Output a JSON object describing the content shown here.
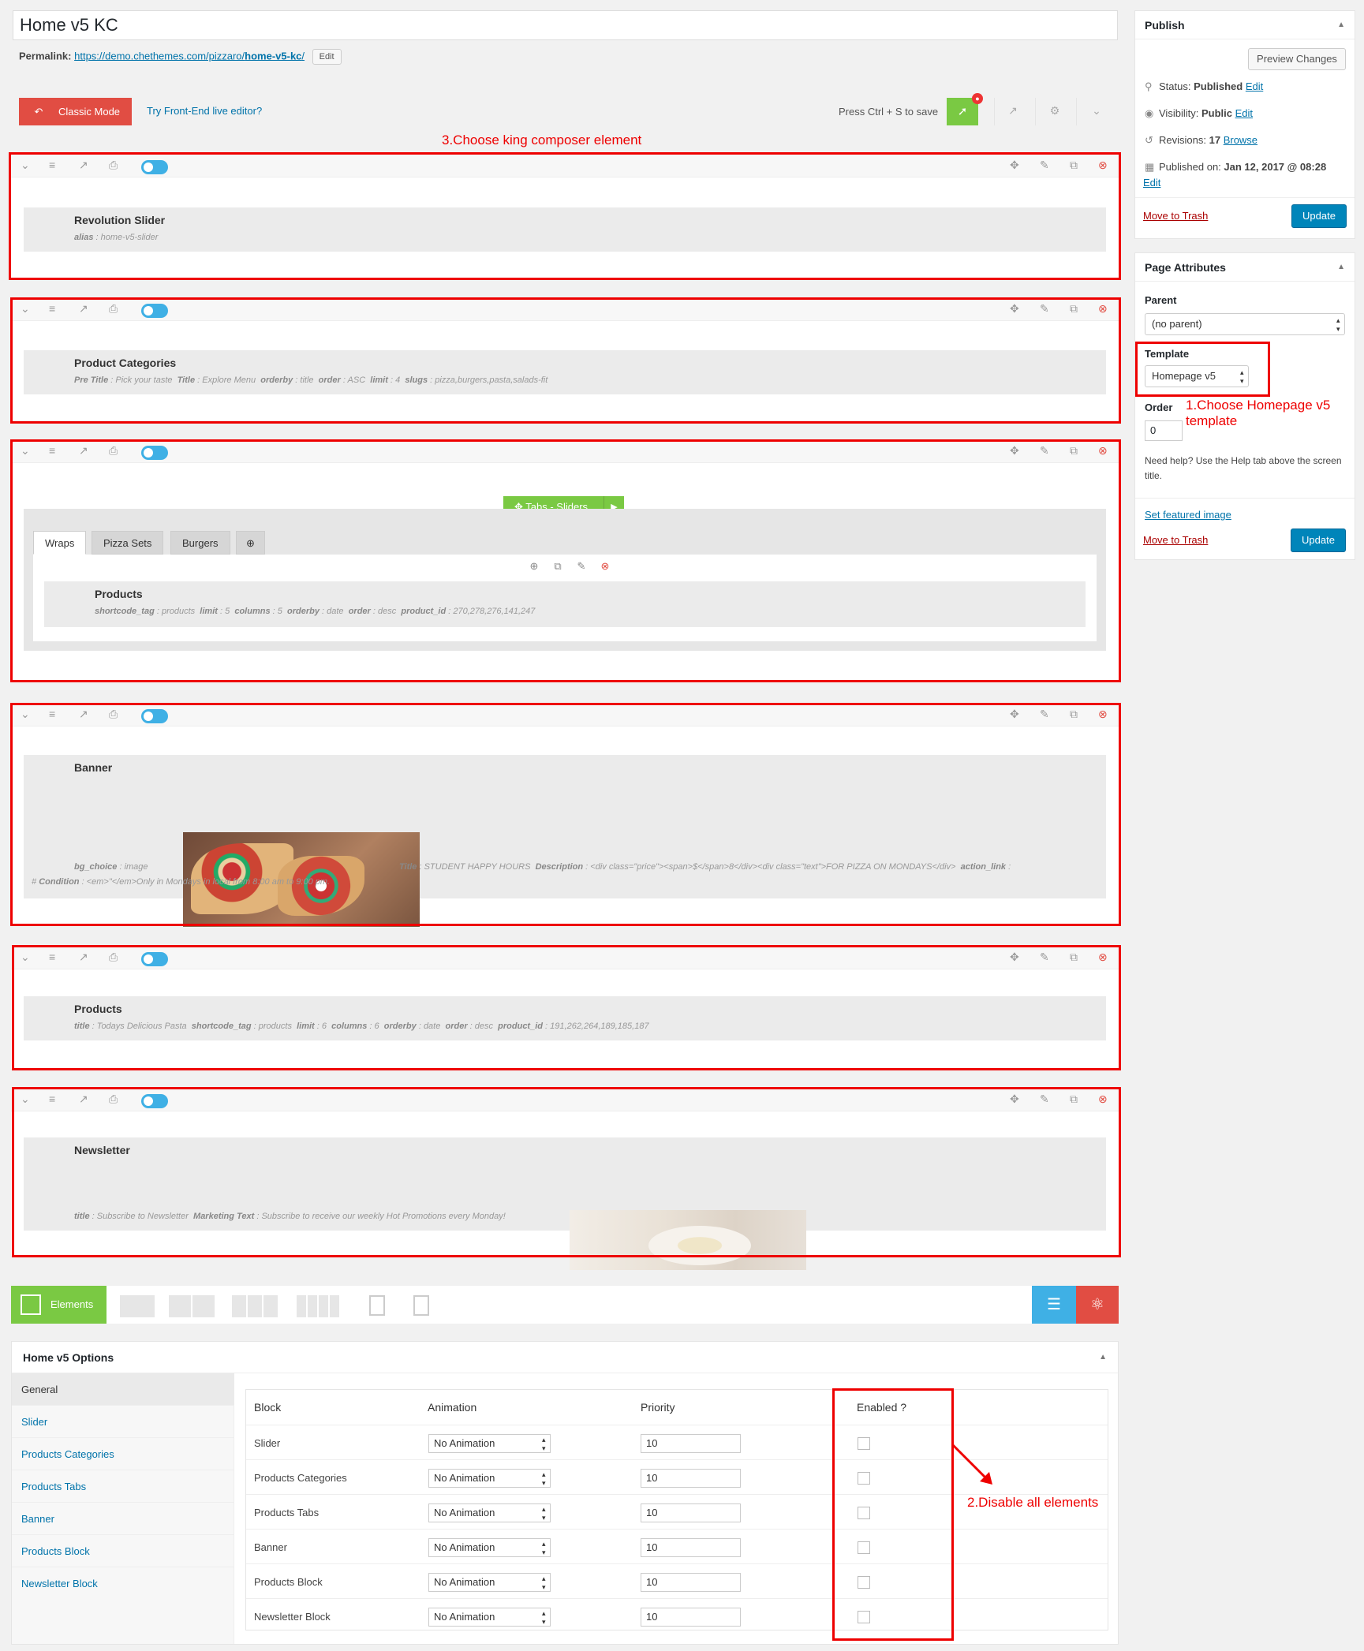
{
  "post": {
    "title": "Home v5 KC",
    "permalink_label": "Permalink:",
    "permalink_base": "https://demo.chethemes.com/pizzaro/",
    "permalink_slug": "home-v5-kc",
    "permalink_end": "/",
    "edit_label": "Edit"
  },
  "kc_toolbar": {
    "classic_mode": "Classic Mode",
    "frontend_link": "Try Front-End live editor?",
    "save_hint": "Press Ctrl + S to save"
  },
  "annotations": {
    "step3": "3.Choose king composer element",
    "step1": "1.Choose Homepage v5 template",
    "step2": "2.Disable all elements"
  },
  "rows": [
    {
      "name": "Revolution Slider",
      "attrs": [
        [
          "alias",
          "home-v5-slider"
        ]
      ]
    },
    {
      "name": "Product Categories",
      "attrs": [
        [
          "Pre Title",
          "Pick your taste"
        ],
        [
          "Title",
          "Explore Menu"
        ],
        [
          "orderby",
          "title"
        ],
        [
          "order",
          "ASC"
        ],
        [
          "limit",
          "4"
        ],
        [
          "slugs",
          "pizza,burgers,pasta,salads-fit"
        ]
      ]
    },
    {
      "name": "Tabs - Sliders"
    },
    {
      "name": "Banner"
    },
    {
      "name": "Products",
      "attrs": [
        [
          "title",
          "Todays Delicious Pasta"
        ],
        [
          "shortcode_tag",
          "products"
        ],
        [
          "limit",
          "6"
        ],
        [
          "columns",
          "6"
        ],
        [
          "orderby",
          "date"
        ],
        [
          "order",
          "desc"
        ],
        [
          "product_id",
          "191,262,264,189,185,187"
        ]
      ]
    },
    {
      "name": "Newsletter",
      "attrs": [
        [
          "title",
          "Subscribe to Newsletter"
        ],
        [
          "Marketing Text",
          "Subscribe to receive our weekly Hot Promotions every Monday!"
        ]
      ]
    }
  ],
  "tabs_block": {
    "button": "Tabs - Sliders",
    "tabs": [
      "Wraps",
      "Pizza Sets",
      "Burgers"
    ],
    "inner_name": "Products",
    "inner_attrs": [
      [
        "shortcode_tag",
        "products"
      ],
      [
        "limit",
        "5"
      ],
      [
        "columns",
        "5"
      ],
      [
        "orderby",
        "date"
      ],
      [
        "order",
        "desc"
      ],
      [
        "product_id",
        "270,278,276,141,247"
      ]
    ]
  },
  "banner": {
    "bg_choice_label": "bg_choice",
    "bg_choice_value": "image",
    "line1_rest": [
      [
        "Title",
        "STUDENT HAPPY HOURS"
      ],
      [
        "Description",
        "<div class=\"price\"><span>$</span>8</div><div class=\"text\">FOR PIZZA ON MONDAYS</div>"
      ],
      [
        "action_link",
        ""
      ]
    ],
    "line2_prefix": "#",
    "line2": [
      [
        "Condition",
        "<em>\"</em>Only in Mondays in local from 8:00 am to 9:00 pm."
      ]
    ]
  },
  "elements_bar": {
    "label": "Elements"
  },
  "options": {
    "title": "Home v5 Options",
    "nav": [
      "General",
      "Slider",
      "Products Categories",
      "Products Tabs",
      "Banner",
      "Products Block",
      "Newsletter Block"
    ],
    "headers": {
      "block": "Block",
      "animation": "Animation",
      "priority": "Priority",
      "enabled": "Enabled ?"
    },
    "rows": [
      {
        "block": "Slider",
        "animation": "No Animation",
        "priority": "10"
      },
      {
        "block": "Products Categories",
        "animation": "No Animation",
        "priority": "10"
      },
      {
        "block": "Products Tabs",
        "animation": "No Animation",
        "priority": "10"
      },
      {
        "block": "Banner",
        "animation": "No Animation",
        "priority": "10"
      },
      {
        "block": "Products Block",
        "animation": "No Animation",
        "priority": "10"
      },
      {
        "block": "Newsletter Block",
        "animation": "No Animation",
        "priority": "10"
      }
    ]
  },
  "publish": {
    "title": "Publish",
    "preview": "Preview Changes",
    "status_label": "Status:",
    "status_value": "Published",
    "visibility_label": "Visibility:",
    "visibility_value": "Public",
    "revisions_label": "Revisions:",
    "revisions_value": "17",
    "browse": "Browse",
    "published_label": "Published on:",
    "published_value": "Jan 12, 2017 @ 08:28",
    "edit": "Edit",
    "trash": "Move to Trash",
    "update": "Update"
  },
  "attributes": {
    "title": "Page Attributes",
    "parent_label": "Parent",
    "parent_value": "(no parent)",
    "template_label": "Template",
    "template_value": "Homepage v5",
    "order_label": "Order",
    "order_value": "0",
    "help": "Need help? Use the Help tab above the screen title.",
    "featured": "Set featured image",
    "trash": "Move to Trash",
    "update": "Update"
  }
}
